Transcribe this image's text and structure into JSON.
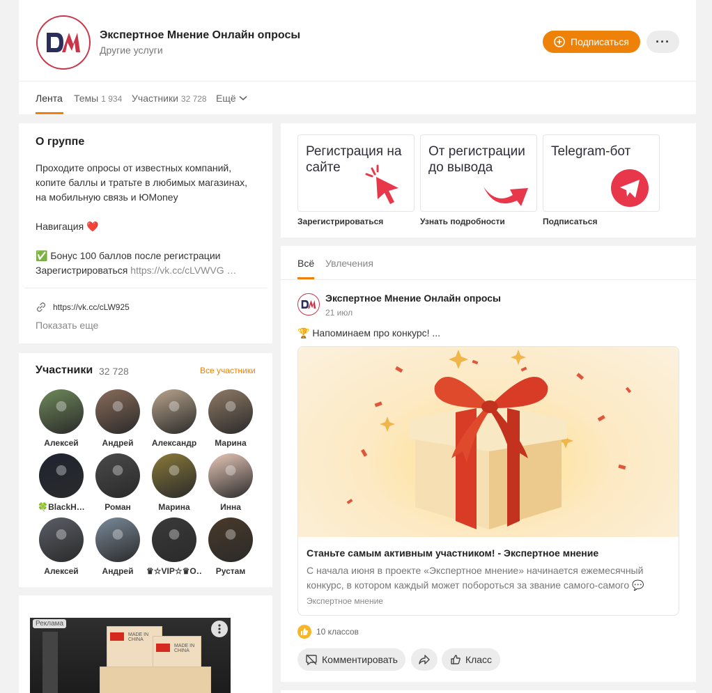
{
  "header": {
    "title": "Экспертное Мнение Онлайн опросы",
    "category": "Другие услуги",
    "subscribe_label": "Подписаться",
    "more_label": "···",
    "tabs": [
      {
        "label": "Лента",
        "count": ""
      },
      {
        "label": "Темы",
        "count": "1 934"
      },
      {
        "label": "Участники",
        "count": "32 728"
      },
      {
        "label": "Ещё",
        "count": ""
      }
    ]
  },
  "about": {
    "title": "О группе",
    "lines": [
      "Проходите опросы от известных компаний, копите баллы и тратьте в любимых магазинах, на мобильную связь и ЮMoney",
      "",
      "Навигация ❤️",
      "",
      "✅ Бонус 100 баллов после регистрации"
    ],
    "register_text": "Зарегистрироваться",
    "register_link": "https://vk.cc/cLVWVG …",
    "url": "https://vk.cc/cLW925",
    "show_more": "Показать еще"
  },
  "members": {
    "title": "Участники",
    "count": "32 728",
    "all_label": "Все участники",
    "list": [
      {
        "name": "Алексей",
        "color": "#6f8a5a"
      },
      {
        "name": "Андрей",
        "color": "#8a6c5a"
      },
      {
        "name": "Александр",
        "color": "#b9a48c"
      },
      {
        "name": "Марина",
        "color": "#8f7a66"
      },
      {
        "name": "🍀BlackH…",
        "color": "#1e2430"
      },
      {
        "name": "Роман",
        "color": "#4a4a4a"
      },
      {
        "name": "Марина",
        "color": "#8a7a3a"
      },
      {
        "name": "Инна",
        "color": "#e8c9b9"
      },
      {
        "name": "Алексей",
        "color": "#5a5e66"
      },
      {
        "name": "Андрей",
        "color": "#7a8a9a"
      },
      {
        "name": "♛☆VIP☆♛O…",
        "color": "#3a3a3a"
      },
      {
        "name": "Рустам",
        "color": "#4a3a2a"
      }
    ]
  },
  "ad": {
    "label": "Реклама",
    "box_text": "MADE IN CHINA"
  },
  "links": [
    {
      "title": "Регистрация на сайте",
      "caption": "Зарегистрироваться"
    },
    {
      "title": "От регистрации до вывода",
      "caption": "Узнать подробности"
    },
    {
      "title": "Telegram-бот",
      "caption": "Подписаться"
    }
  ],
  "feed": {
    "tabs": [
      "Всё",
      "Увлечения"
    ],
    "post": {
      "author": "Экспертное Мнение Онлайн опросы",
      "date": "21 июл",
      "text": "🏆 Напоминаем про конкурс! ...",
      "media_title": "Станьте самым активным участником! - Экспертное мнение",
      "media_desc": "С начала июня в проекте «Экспертное мнение» начинается ежемесячный конкурс, в котором каждый может побороться за звание самого-самого 💬",
      "media_source": "Экспертное мнение",
      "likes": "10 классов",
      "comment_label": "Комментировать",
      "like_label": "Класс"
    }
  },
  "colors": {
    "accent": "#ee8208",
    "brand_red": "#c9364a",
    "brand_navy": "#2b2d5a"
  }
}
